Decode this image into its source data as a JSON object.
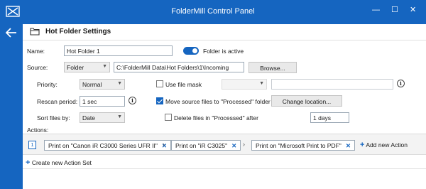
{
  "window": {
    "title": "FolderMill Control Panel",
    "minimize": "—",
    "maximize": "☐",
    "close": "✕"
  },
  "header": {
    "title": "Hot Folder Settings"
  },
  "form": {
    "name_label": "Name:",
    "name_value": "Hot Folder 1",
    "active_label": "Folder is active",
    "source_label": "Source:",
    "source_type": "Folder",
    "source_path": "C:\\FolderMill Data\\Hot Folders\\1\\Incoming",
    "browse_label": "Browse...",
    "priority_label": "Priority:",
    "priority_value": "Normal",
    "rescan_label": "Rescan period:",
    "rescan_value": "1 sec",
    "sort_label": "Sort files by:",
    "sort_value": "Date",
    "file_mask_label": "Use file mask",
    "move_label": "Move source files to \"Processed\" folder",
    "change_location_label": "Change location...",
    "delete_label": "Delete files in \"Processed\" after",
    "delete_days": "1 days"
  },
  "actions": {
    "label": "Actions:",
    "set_number": "1",
    "items": [
      "Print on \"Canon iR C3000 Series UFR II\"",
      "Print on \"iR C3025\"",
      "Print on \"Microsoft Print to PDF\""
    ],
    "add_action": "Add new Action",
    "create_set": "Create new Action Set"
  },
  "colors": {
    "accent": "#1565c0"
  }
}
